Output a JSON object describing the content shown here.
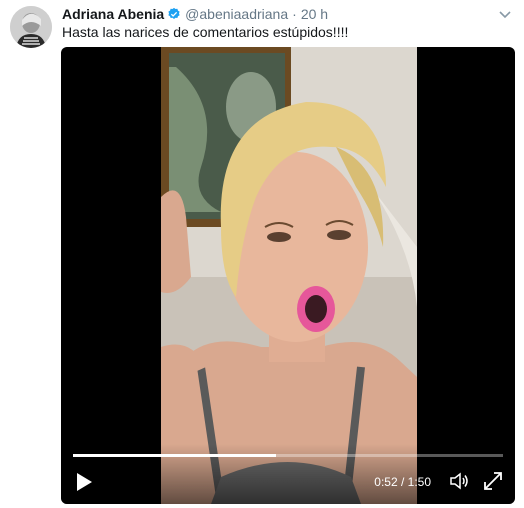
{
  "tweet": {
    "display_name": "Adriana Abenia",
    "verified": true,
    "handle": "@abeniaadriana",
    "separator": "·",
    "time": "20 h",
    "text": "Hasta las narices de comentarios estúpidos!!!!"
  },
  "video": {
    "current_time": "0:52",
    "duration": "1:50",
    "time_display": "0:52 / 1:50",
    "progress": 0.473
  },
  "icons": {
    "verified": "verified-badge-icon",
    "caret": "chevron-down-icon",
    "play": "play-icon",
    "volume": "volume-icon",
    "fullscreen": "fullscreen-icon"
  },
  "colors": {
    "verified": "#1da1f2",
    "muted_text": "#657786",
    "video_bg": "#000000"
  }
}
